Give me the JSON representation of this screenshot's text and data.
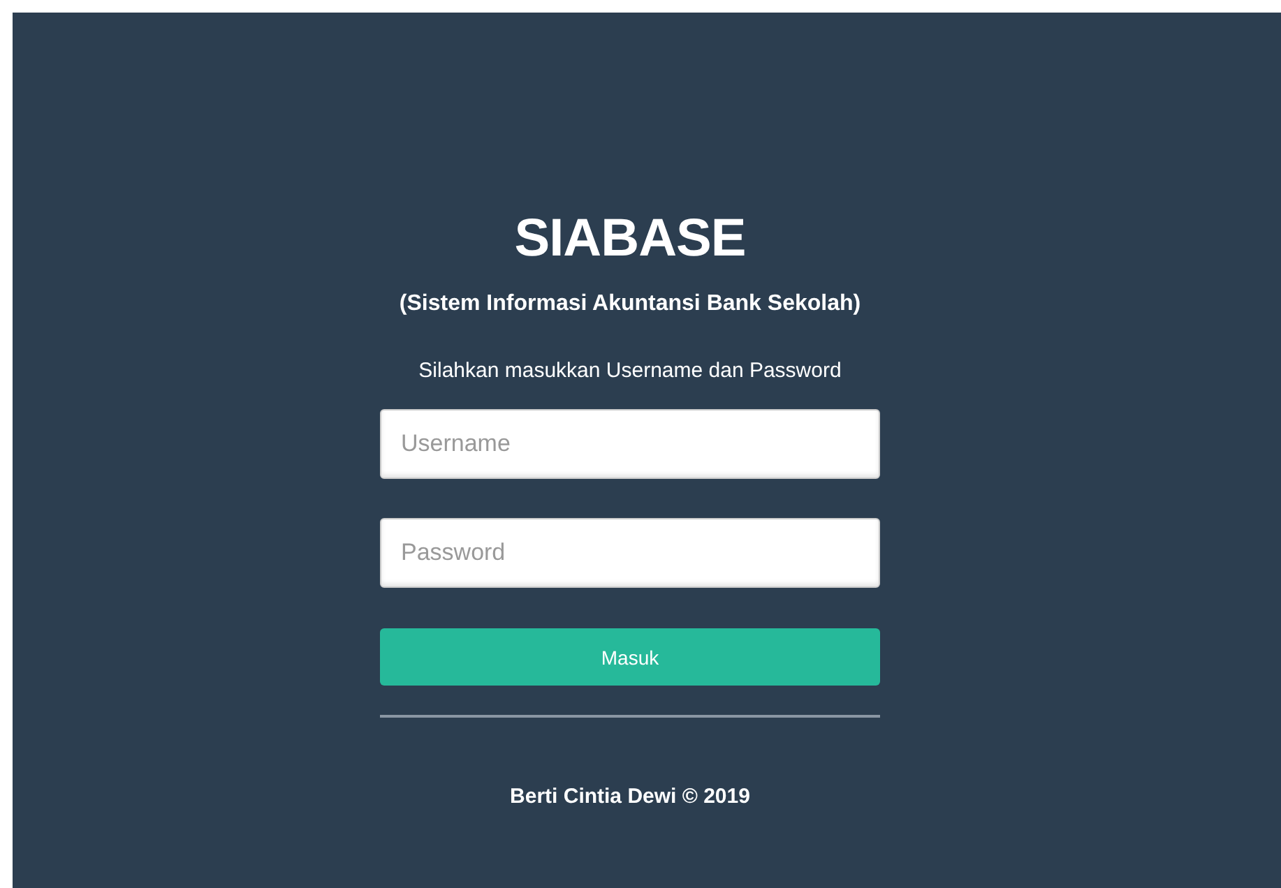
{
  "title": "SIABASE",
  "subtitle": "(Sistem Informasi Akuntansi Bank Sekolah)",
  "instruction": "Silahkan masukkan Username dan Password",
  "fields": [
    {
      "placeholder": "Username"
    },
    {
      "placeholder": "Password"
    }
  ],
  "button": "Masuk",
  "footer": "Berti Cintia Dewi © 2019"
}
